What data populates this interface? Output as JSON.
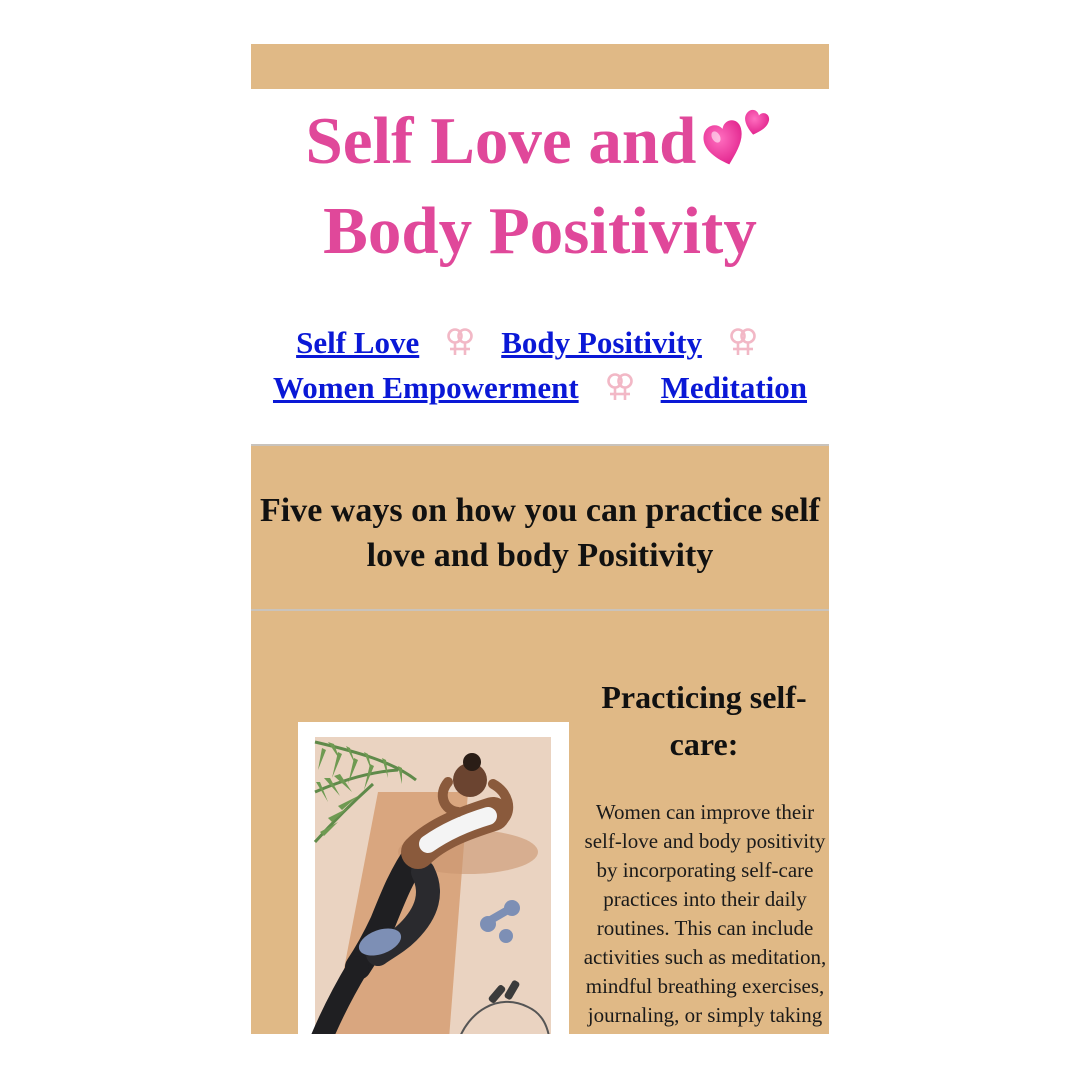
{
  "header": {
    "title_line1": "Self Love and",
    "title_line2": "Body Positivity",
    "title_emoji": "two-hearts-icon"
  },
  "nav": {
    "items": [
      {
        "label": "Self Love"
      },
      {
        "label": "Body Positivity"
      },
      {
        "label": "Women Empowerment"
      },
      {
        "label": "Meditation"
      }
    ],
    "separator_icon": "double-female-sign-icon"
  },
  "section": {
    "heading_line1": "Five ways on how you can practice self",
    "heading_line2": "love and body Positivity"
  },
  "card": {
    "title_line1": "Practicing self-",
    "title_line2": "care:",
    "body_lines": [
      "Women can improve their",
      "self-love and body positivity",
      "by incorporating self-care",
      "practices into their daily",
      "routines. This can include",
      "activities such as meditation,",
      "mindful breathing exercises,",
      "journaling, or simply taking"
    ],
    "image_icon": "woman-exercising-illustration"
  },
  "colors": {
    "accent_pink": "#e0489a",
    "tan_background": "#e0b986",
    "link_blue": "#0a18d6"
  }
}
